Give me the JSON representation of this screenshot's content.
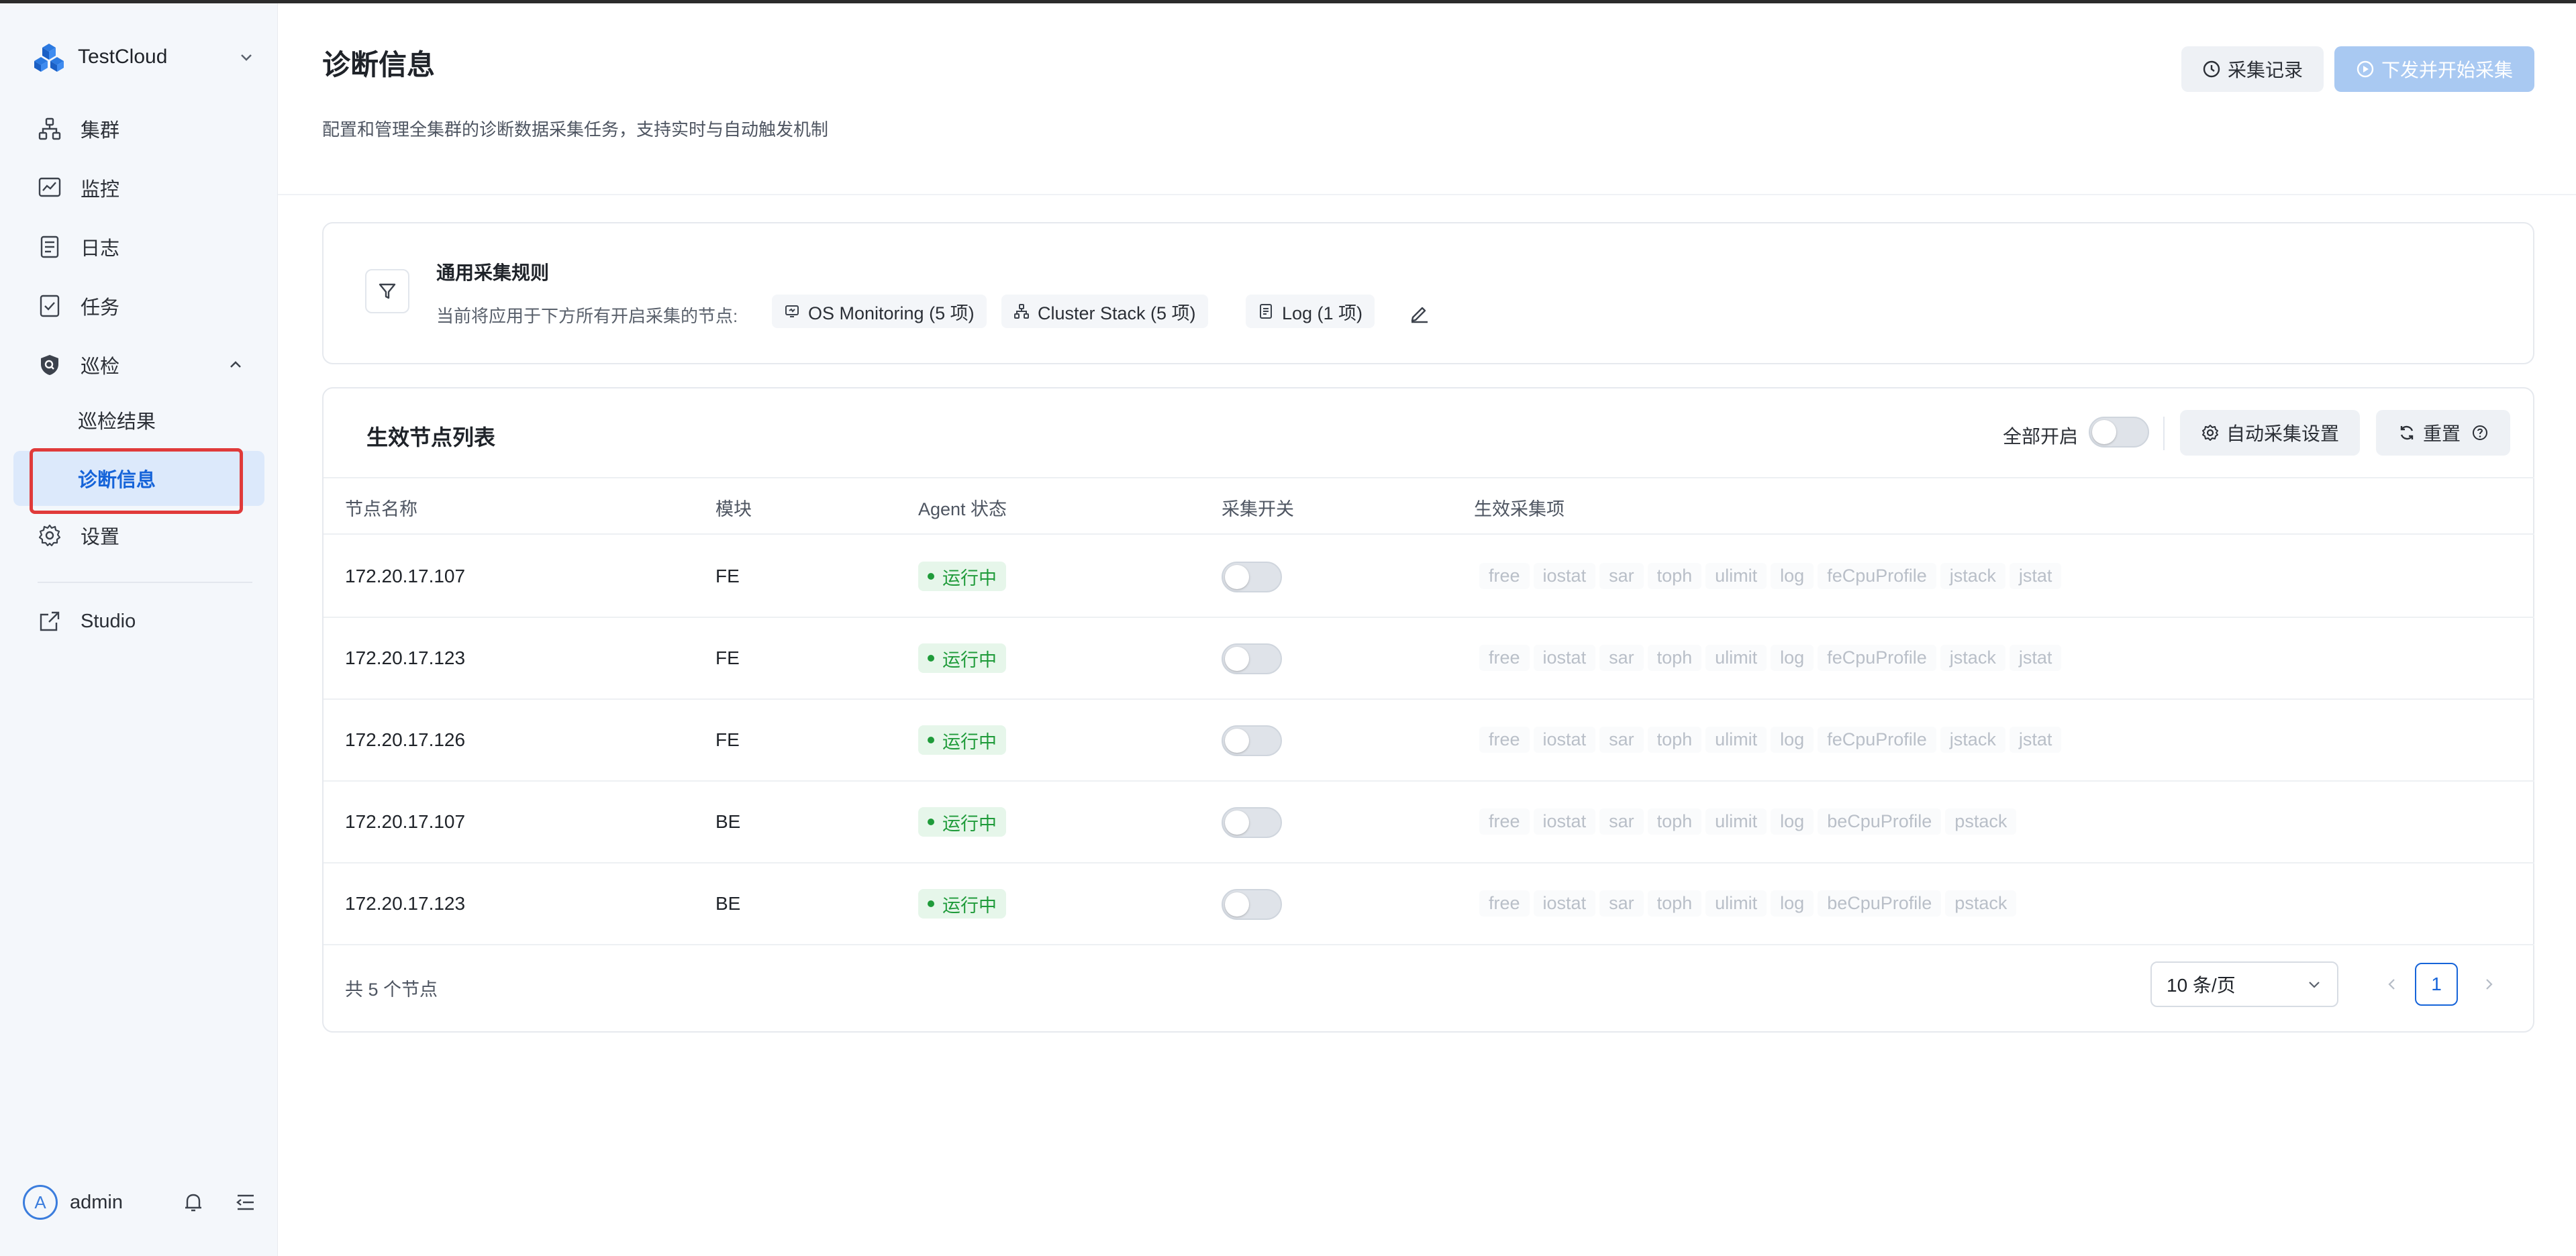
{
  "sidebar": {
    "brand": "TestCloud",
    "items": [
      {
        "label": "集群",
        "icon": "cluster-icon"
      },
      {
        "label": "监控",
        "icon": "monitor-chart-icon"
      },
      {
        "label": "日志",
        "icon": "document-icon"
      },
      {
        "label": "任务",
        "icon": "task-icon"
      },
      {
        "label": "巡检",
        "icon": "shield-icon"
      }
    ],
    "sub_items": [
      {
        "label": "巡检结果"
      },
      {
        "label": "诊断信息",
        "active": true
      }
    ],
    "settings": "设置",
    "studio": "Studio",
    "user": {
      "initial": "A",
      "name": "admin"
    }
  },
  "header": {
    "title": "诊断信息",
    "description": "配置和管理全集群的诊断数据采集任务，支持实时与自动触发机制",
    "records_button": "采集记录",
    "start_button": "下发并开始采集"
  },
  "rules": {
    "title": "通用采集规则",
    "subtitle": "当前将应用于下方所有开启采集的节点:",
    "chips": [
      "OS Monitoring (5 项)",
      "Cluster Stack (5 项)",
      "Log (1 项)"
    ]
  },
  "node_list": {
    "title": "生效节点列表",
    "all_on_label": "全部开启",
    "all_on": false,
    "auto_button": "自动采集设置",
    "reset_button": "重置",
    "columns": [
      "节点名称",
      "模块",
      "Agent 状态",
      "采集开关",
      "生效采集项"
    ],
    "rows": [
      {
        "name": "172.20.17.107",
        "module": "FE",
        "status": "运行中",
        "enabled": false,
        "items": [
          "free",
          "iostat",
          "sar",
          "toph",
          "ulimit",
          "log",
          "feCpuProfile",
          "jstack",
          "jstat"
        ]
      },
      {
        "name": "172.20.17.123",
        "module": "FE",
        "status": "运行中",
        "enabled": false,
        "items": [
          "free",
          "iostat",
          "sar",
          "toph",
          "ulimit",
          "log",
          "feCpuProfile",
          "jstack",
          "jstat"
        ]
      },
      {
        "name": "172.20.17.126",
        "module": "FE",
        "status": "运行中",
        "enabled": false,
        "items": [
          "free",
          "iostat",
          "sar",
          "toph",
          "ulimit",
          "log",
          "feCpuProfile",
          "jstack",
          "jstat"
        ]
      },
      {
        "name": "172.20.17.107",
        "module": "BE",
        "status": "运行中",
        "enabled": false,
        "items": [
          "free",
          "iostat",
          "sar",
          "toph",
          "ulimit",
          "log",
          "beCpuProfile",
          "pstack"
        ]
      },
      {
        "name": "172.20.17.123",
        "module": "BE",
        "status": "运行中",
        "enabled": false,
        "items": [
          "free",
          "iostat",
          "sar",
          "toph",
          "ulimit",
          "log",
          "beCpuProfile",
          "pstack"
        ]
      }
    ],
    "total": "共 5 个节点",
    "page_size": "10 条/页",
    "current_page": "1"
  },
  "colors": {
    "accent": "#1664d9",
    "status_green": "#1f9b3a",
    "highlight_red": "#e03a3a"
  }
}
